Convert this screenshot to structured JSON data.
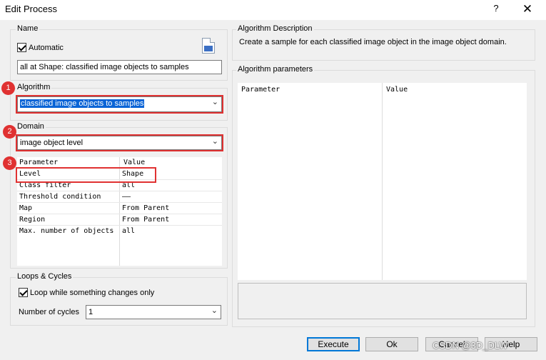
{
  "window": {
    "title": "Edit Process",
    "help_label": "?",
    "close_label": "✕"
  },
  "name_group": {
    "label": "Name",
    "automatic_label": "Automatic",
    "automatic_checked": true,
    "name_value": "all at  Shape: classified image objects to samples"
  },
  "algorithm_group": {
    "label": "Algorithm",
    "selected": "classified image objects to samples"
  },
  "domain_group": {
    "label": "Domain",
    "selected": "image object level",
    "columns": [
      "Parameter",
      "Value"
    ],
    "rows": [
      {
        "parameter": "Level",
        "value": "Shape"
      },
      {
        "parameter": "Class filter",
        "value": "all"
      },
      {
        "parameter": "Threshold condition",
        "value": "——"
      },
      {
        "parameter": "Map",
        "value": "From Parent"
      },
      {
        "parameter": "Region",
        "value": "From Parent"
      },
      {
        "parameter": "Max. number of objects",
        "value": "all"
      }
    ]
  },
  "loops_group": {
    "label": "Loops & Cycles",
    "loop_label": "Loop while something changes only",
    "loop_checked": true,
    "cycles_label": "Number of cycles",
    "cycles_value": "1"
  },
  "description_group": {
    "label": "Algorithm Description",
    "text": "Create a sample for each classified image object in the image object domain."
  },
  "params_group": {
    "label": "Algorithm parameters",
    "columns": [
      "Parameter",
      "Value"
    ]
  },
  "buttons": {
    "execute": "Execute",
    "ok": "Ok",
    "cancel": "Cancel",
    "help": "Help"
  },
  "annotations": [
    "1",
    "2",
    "3"
  ],
  "watermark": "CSDN @3D_DLW",
  "colors": {
    "highlight": "#0a64d6",
    "annotation_red": "#e03131",
    "dialog_bg": "#f0f0f0"
  }
}
